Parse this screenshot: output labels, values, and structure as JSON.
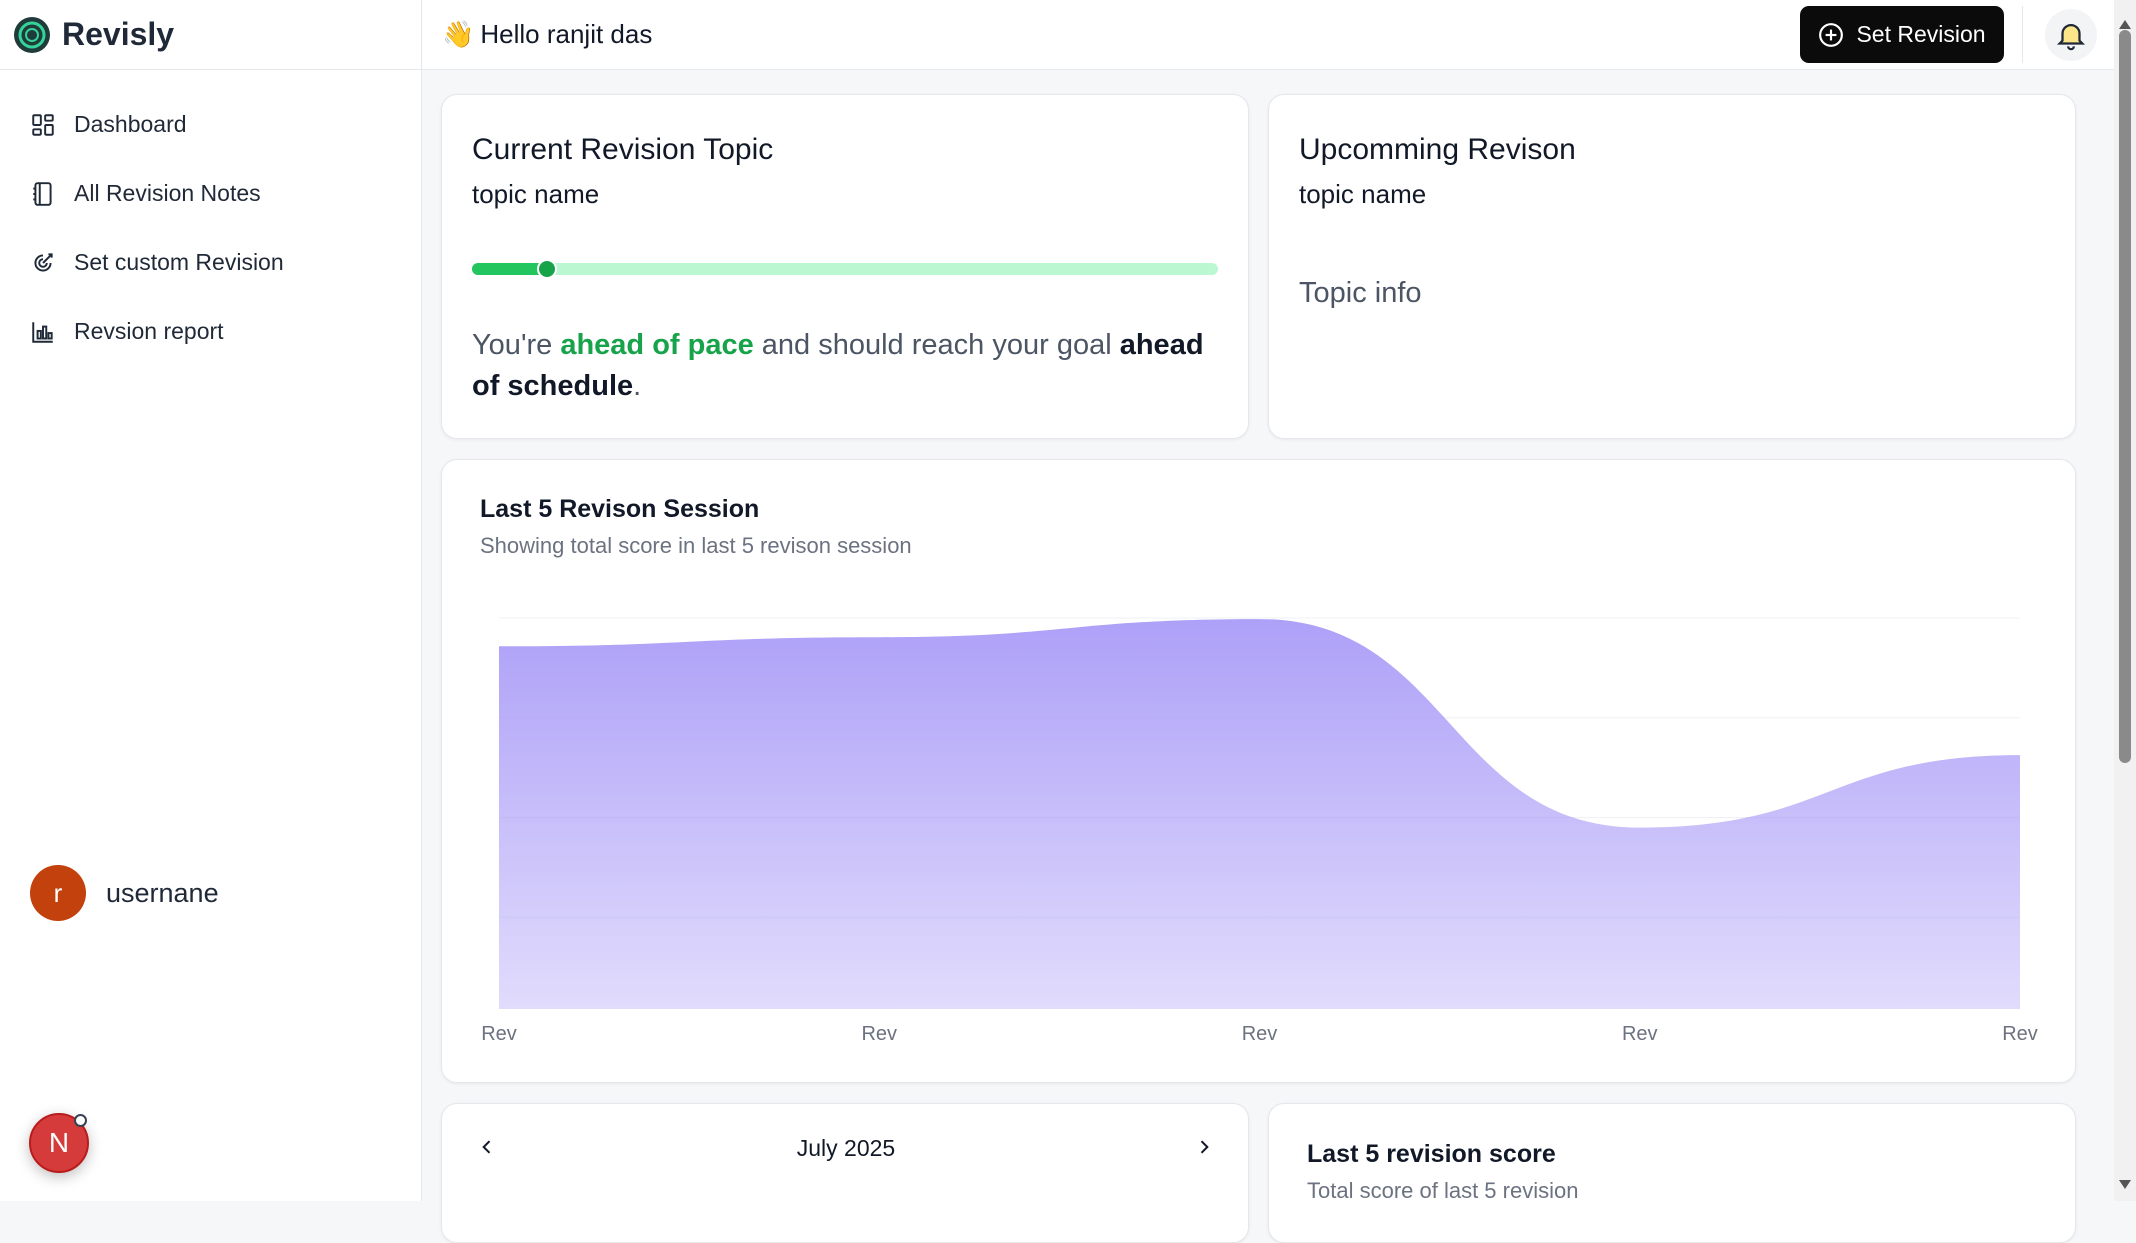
{
  "app": {
    "name": "Revisly"
  },
  "header": {
    "greeting": "Hello ranjit das",
    "wave": "👋",
    "set_revision_label": "Set Revision"
  },
  "sidebar": {
    "items": [
      {
        "label": "Dashboard",
        "icon": "dashboard-icon"
      },
      {
        "label": "All Revision Notes",
        "icon": "notebook-icon"
      },
      {
        "label": "Set custom Revision",
        "icon": "target-icon"
      },
      {
        "label": "Revsion report",
        "icon": "bar-chart-icon"
      }
    ],
    "user": {
      "initial": "r",
      "name": "usernane"
    },
    "fab_initial": "N"
  },
  "current": {
    "title": "Current Revision Topic",
    "topic": "topic name",
    "progress": 0.1,
    "pace_prefix": "You're ",
    "pace_green": "ahead of pace",
    "pace_middle": " and should reach your goal ",
    "pace_strong": "ahead of schedule",
    "pace_suffix": "."
  },
  "upcoming": {
    "title": "Upcomming Revison",
    "topic": "topic name",
    "info": "Topic info"
  },
  "session_chart": {
    "title": "Last 5 Revison Session",
    "subtitle": "Showing total score in last 5 revison session"
  },
  "chart_data": {
    "type": "area",
    "title": "Last 5 Revison Session",
    "subtitle": "Showing total score in last 5 revison session",
    "categories": [
      "Rev",
      "Rev",
      "Rev",
      "Rev",
      "Rev"
    ],
    "values": [
      4.0,
      4.1,
      4.3,
      2.0,
      2.8
    ],
    "ylim": [
      0,
      4.4
    ],
    "grid": true,
    "color": "#a99bf7"
  },
  "calendar": {
    "month": "July 2025"
  },
  "score": {
    "title": "Last 5 revision score",
    "subtitle": "Total score of last 5 revision"
  },
  "colors": {
    "accent": "#0b0b0b",
    "green": "#16a34a",
    "chart_fill": "#a99bf7"
  }
}
